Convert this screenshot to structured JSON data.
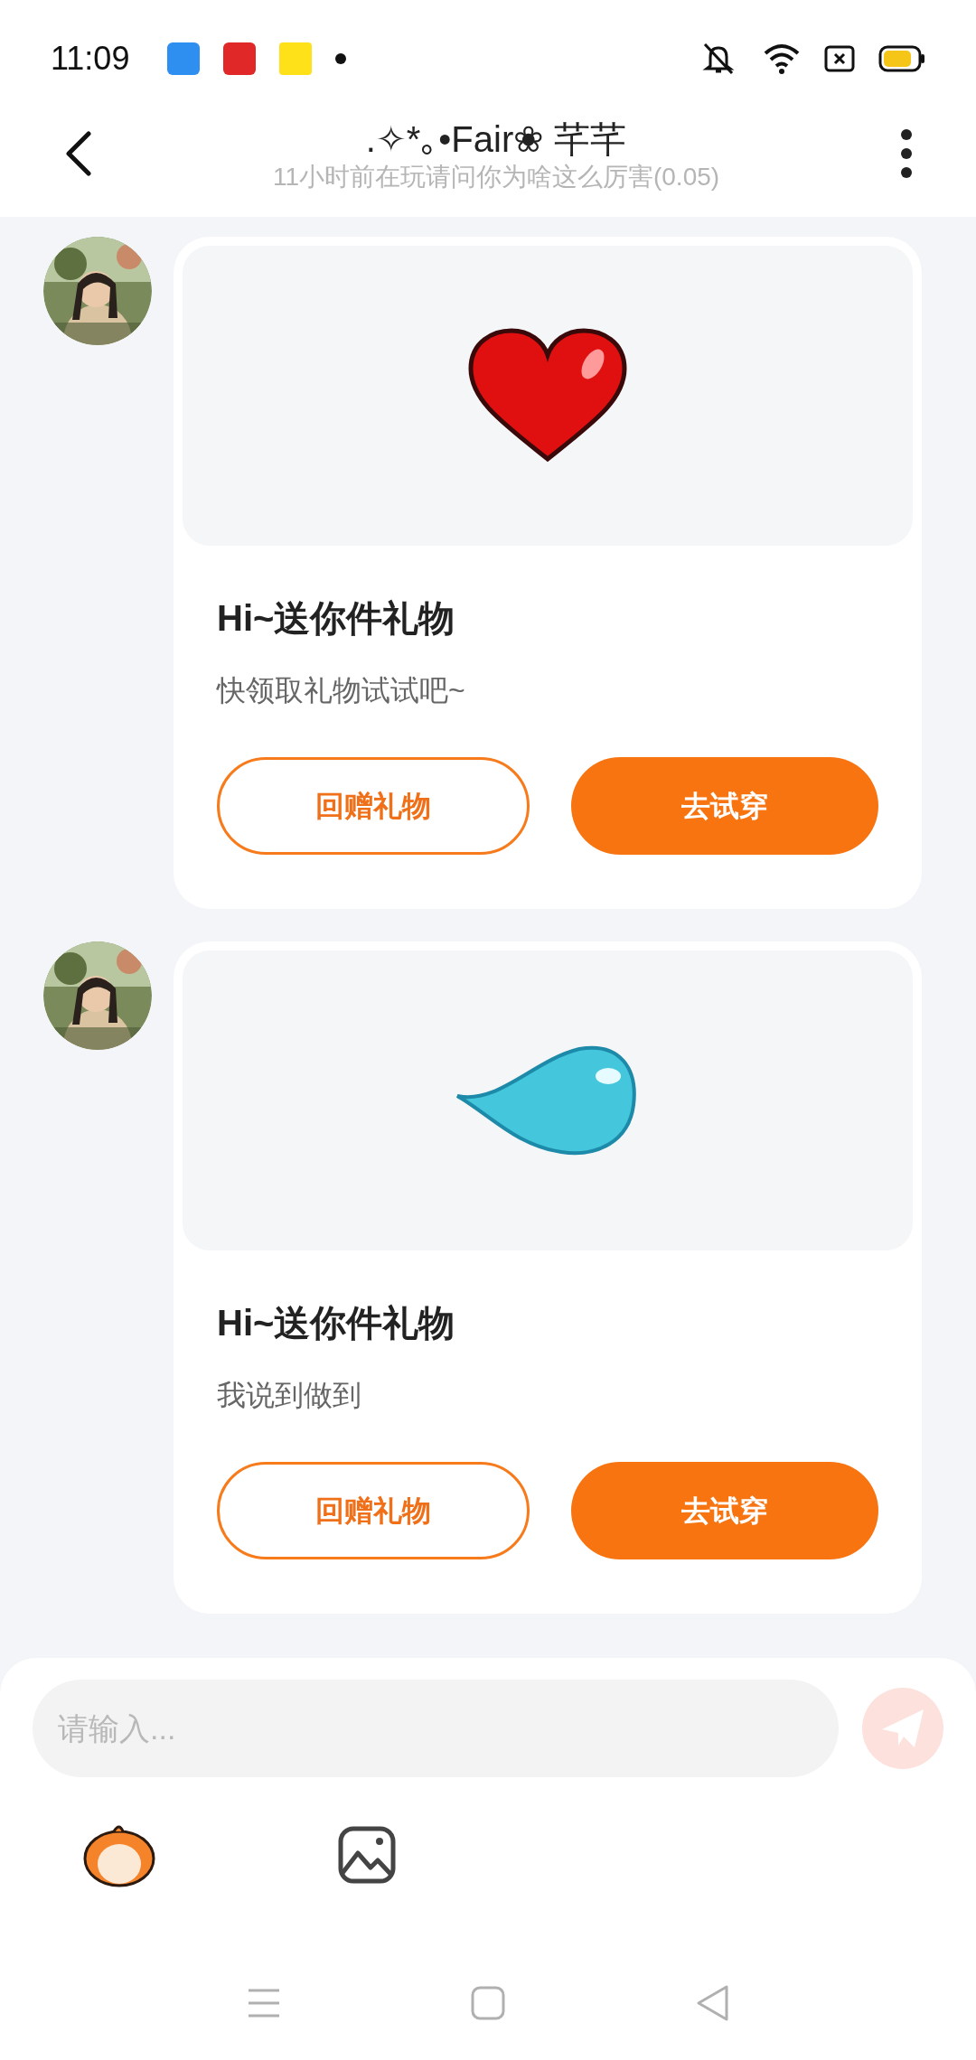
{
  "status_bar": {
    "time": "11:09"
  },
  "header": {
    "title": ".✧*｡•Fair❀ 芊芊",
    "subtitle": "11小时前在玩请问你为啥这么厉害(0.05)"
  },
  "messages": [
    {
      "kind": "heart",
      "title": "Hi~送你件礼物",
      "text": "快领取礼物试试吧~",
      "buttons": [
        {
          "label": "回赠礼物",
          "kind": "outline"
        },
        {
          "label": "去试穿",
          "kind": "filled"
        }
      ]
    },
    {
      "kind": "drop",
      "title": "Hi~送你件礼物",
      "text": "我说到做到",
      "buttons": [
        {
          "label": "回赠礼物",
          "kind": "outline"
        },
        {
          "label": "去试穿",
          "kind": "filled"
        }
      ]
    }
  ],
  "composer": {
    "placeholder": "请输入..."
  }
}
